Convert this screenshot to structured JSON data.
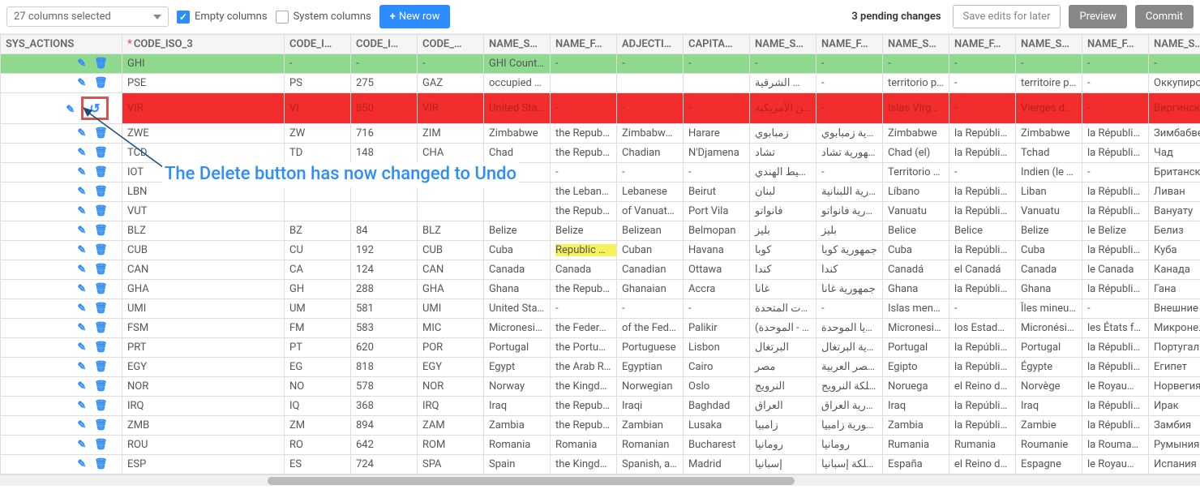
{
  "toolbar": {
    "dropdown_label": "27 columns selected",
    "empty_columns_label": "Empty columns",
    "empty_columns_checked": true,
    "system_columns_label": "System columns",
    "system_columns_checked": false,
    "new_row_label": "New row",
    "pending_text": "3 pending changes",
    "save_label": "Save edits for later",
    "preview_label": "Preview",
    "commit_label": "Commit"
  },
  "annotation": "The Delete button has now changed to Undo",
  "columns": [
    "SYS_ACTIONS",
    "CODE_ISO_3",
    "CODE_I…",
    "CODE_I…",
    "CODE_…",
    "NAME_S…",
    "NAME_F…",
    "ADJECTI…",
    "CAPITA…",
    "NAME_S…",
    "NAME_F…",
    "NAME_S…",
    "NAME_F…",
    "NAME_S…",
    "NAME_F…",
    "NAME_S…"
  ],
  "rows": [
    {
      "state": "new",
      "undo": false,
      "cells": [
        "GHI",
        "-",
        "-",
        "-",
        "GHI Country",
        "-",
        "-",
        "-",
        "-",
        "-",
        "-",
        "-",
        "-",
        "-",
        "-"
      ]
    },
    {
      "state": "",
      "undo": false,
      "cells": [
        "PSE",
        "PS",
        "275",
        "GAZ",
        "occupied Pal",
        "",
        "",
        "",
        "فيها القدس الشرقية",
        "-",
        "territorio pale",
        "-",
        "territoire pale",
        "-",
        "Оккупирован"
      ]
    },
    {
      "state": "del",
      "undo": true,
      "cells": [
        "VIR",
        "VI",
        "850",
        "VIR",
        "United States",
        "-",
        "-",
        "-",
        "جزر فرجن الأمريكية",
        "-",
        "Islas Vírgenes",
        "-",
        "Vierges des É",
        "-",
        "Виргинские"
      ]
    },
    {
      "state": "",
      "undo": false,
      "cells": [
        "ZWE",
        "ZW",
        "716",
        "ZIM",
        "Zimbabwe",
        "the Republic",
        "Zimbabwean",
        "Harare",
        "زمبابوي",
        "جمهورية زمبابوي",
        "Zimbabwe",
        "la República d",
        "Zimbabwe",
        "la République",
        "Зимбабве"
      ]
    },
    {
      "state": "",
      "undo": false,
      "cells": [
        "TCD",
        "TD",
        "148",
        "CHA",
        "Chad",
        "the Republic",
        "Chadian",
        "N'Djamena",
        "تشاد",
        "جمهورية تشاد",
        "Chad (el)",
        "la República d",
        "Tchad",
        "la République",
        "Чад"
      ]
    },
    {
      "state": "",
      "undo": false,
      "cells": [
        "IOT",
        "",
        "",
        "",
        "",
        "-",
        "-",
        "-",
        "في المحيط الهندي",
        "-",
        "Territorio Brita",
        "-",
        "Indien (le Terr",
        "-",
        "Британская т"
      ]
    },
    {
      "state": "",
      "undo": false,
      "cells": [
        "LBN",
        "",
        "",
        "",
        "",
        "the Lebanese",
        "Lebanese",
        "Beirut",
        "لبنان",
        "الجمهورية اللبنانية",
        "Líbano",
        "la República d",
        "Liban",
        "la République",
        "Ливан"
      ]
    },
    {
      "state": "",
      "undo": false,
      "cells": [
        "VUT",
        "",
        "",
        "",
        "",
        "the Republic",
        "of Vanuatu, V",
        "Port Vila",
        "فانواتو",
        "جمهورية فانواتو",
        "Vanuatu",
        "la República d",
        "Vanuatu",
        "la République",
        "Вануату"
      ]
    },
    {
      "state": "",
      "undo": false,
      "hl": 5,
      "cells": [
        "BLZ",
        "BZ",
        "84",
        "BLZ",
        "Belize",
        "Belize",
        "Belizean",
        "Belmopan",
        "بليز",
        "بليز",
        "Belice",
        "Belice",
        "Belize",
        "le Belize",
        "Белиз"
      ]
    },
    {
      "state": "",
      "undo": false,
      "hl": 5,
      "cells": [
        "CUB",
        "CU",
        "192",
        "CUB",
        "Cuba",
        "Republic of C",
        "Cuban",
        "Havana",
        "كوبا",
        "جمهورية كوبا",
        "Cuba",
        "la República d",
        "Cuba",
        "la République",
        "Куба"
      ]
    },
    {
      "state": "",
      "undo": false,
      "cells": [
        "CAN",
        "CA",
        "124",
        "CAN",
        "Canada",
        "Canada",
        "Canadian",
        "Ottawa",
        "كندا",
        "كندا",
        "Canadá",
        "el Canadá",
        "Canada",
        "le Canada",
        "Канада"
      ]
    },
    {
      "state": "",
      "undo": false,
      "cells": [
        "GHA",
        "GH",
        "288",
        "GHA",
        "Ghana",
        "the Republic",
        "Ghanaian",
        "Accra",
        "غانا",
        "جمهورية غانا",
        "Ghana",
        "la República d",
        "Ghana",
        "la République",
        "Гана"
      ]
    },
    {
      "state": "",
      "undo": false,
      "cells": [
        "UMI",
        "UM",
        "581",
        "UMI",
        "United States",
        "-",
        "-",
        "-",
        "للولايات المتحدة",
        "-",
        "Islas menores",
        "-",
        "Îles mineures",
        "-",
        "Внешние ма"
      ]
    },
    {
      "state": "",
      "undo": false,
      "cells": [
        "FSM",
        "FM",
        "583",
        "MIC",
        "Micronesia (F",
        "the Federated",
        "of the Federa",
        "Palikir",
        "(ولايات - الموحدة)",
        "ميكرونيزيا الموحدة",
        "Micronesia (E",
        "los Estados F",
        "Micronésie (É",
        "les États fédé",
        "Микронезия"
      ]
    },
    {
      "state": "",
      "undo": false,
      "cells": [
        "PRT",
        "PT",
        "620",
        "POR",
        "Portugal",
        "the Portugue",
        "Portuguese",
        "Lisbon",
        "البرتغال",
        "جمهورية البرتغال",
        "Portugal",
        "la República d",
        "Portugal",
        "la République",
        "Португалия"
      ]
    },
    {
      "state": "",
      "undo": false,
      "cells": [
        "EGY",
        "EG",
        "818",
        "EGY",
        "Egypt",
        "the Arab Rep",
        "Egyptian",
        "Cairo",
        "مصر",
        "جمهورية مصر العربية",
        "Egipto",
        "la República d",
        "Égypte",
        "la République",
        "Египет"
      ]
    },
    {
      "state": "",
      "undo": false,
      "cells": [
        "NOR",
        "NO",
        "578",
        "NOR",
        "Norway",
        "the Kingdom",
        "Norwegian",
        "Oslo",
        "النرويج",
        "مملكة النرويج",
        "Noruega",
        "el Reino de N",
        "Norvège",
        "le Royaume d",
        "Норвегия"
      ]
    },
    {
      "state": "",
      "undo": false,
      "cells": [
        "IRQ",
        "IQ",
        "368",
        "IRQ",
        "Iraq",
        "the Republic",
        "Iraqi",
        "Baghdad",
        "العراق",
        "جمهورية العراق",
        "Iraq",
        "la República d",
        "Iraq",
        "la République",
        "Ирак"
      ]
    },
    {
      "state": "",
      "undo": false,
      "cells": [
        "ZMB",
        "ZM",
        "894",
        "ZAM",
        "Zambia",
        "the Republic",
        "Zambian",
        "Lusaka",
        "زامبيا",
        "جمهورية زامبيا",
        "Zambia",
        "la República d",
        "Zambie",
        "la République",
        "Замбия"
      ]
    },
    {
      "state": "",
      "undo": false,
      "cells": [
        "ROU",
        "RO",
        "642",
        "ROM",
        "Romania",
        "Romania",
        "Romanian",
        "Bucharest",
        "رومانيا",
        "رومانيا",
        "Rumania",
        "Rumania",
        "Roumanie",
        "la Roumanie",
        "Румыния"
      ]
    },
    {
      "state": "",
      "undo": false,
      "cells": [
        "ESP",
        "ES",
        "724",
        "SPA",
        "Spain",
        "the Kingdom",
        "Spanish, a Sp",
        "Madrid",
        "إسبانيا",
        "مملكة إسبانيا",
        "España",
        "el Reino de E",
        "Espagne",
        "le Royaume d",
        "Испания"
      ]
    }
  ]
}
